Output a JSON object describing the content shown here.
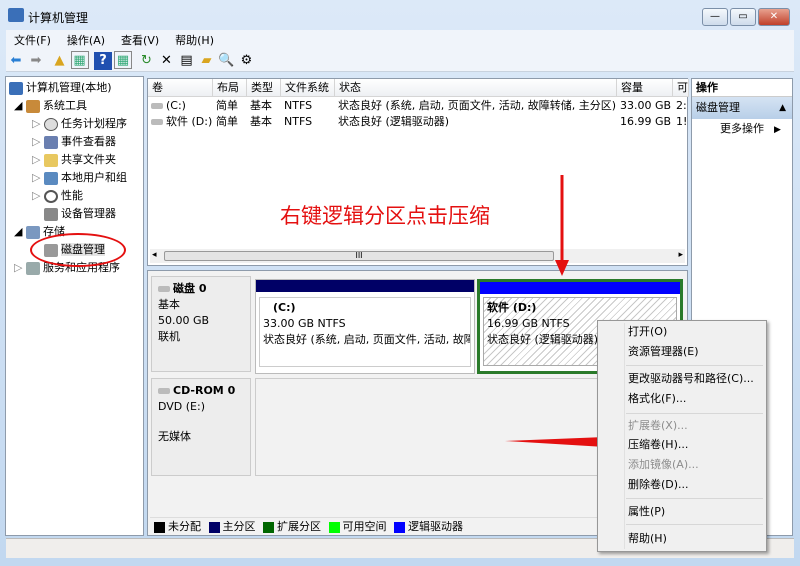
{
  "window": {
    "title": "计算机管理",
    "min": "—",
    "max": "▭",
    "close": "✕"
  },
  "menubar": [
    "文件(F)",
    "操作(A)",
    "查看(V)",
    "帮助(H)"
  ],
  "tree": {
    "root": "计算机管理(本地)",
    "system_tools": "系统工具",
    "task_scheduler": "任务计划程序",
    "event_viewer": "事件查看器",
    "shared_folders": "共享文件夹",
    "local_users": "本地用户和组",
    "performance": "性能",
    "device_manager": "设备管理器",
    "storage": "存储",
    "disk_management": "磁盘管理",
    "services": "服务和应用程序"
  },
  "volume_list": {
    "columns": [
      "卷",
      "布局",
      "类型",
      "文件系统",
      "状态",
      "容量",
      "可"
    ],
    "rows": [
      [
        "(C:)",
        "简单",
        "基本",
        "NTFS",
        "状态良好 (系统, 启动, 页面文件, 活动, 故障转储, 主分区)",
        "33.00 GB",
        "2:"
      ],
      [
        "软件 (D:)",
        "简单",
        "基本",
        "NTFS",
        "状态良好 (逻辑驱动器)",
        "16.99 GB",
        "1!"
      ]
    ],
    "scroll_mid": "III"
  },
  "disks": [
    {
      "name": "磁盘 0",
      "type": "基本",
      "size": "50.00 GB",
      "status": "联机",
      "partitions": [
        {
          "label": "(C:)",
          "size": "33.00 GB NTFS",
          "status": "状态良好 (系统, 启动, 页面文件, 活动, 故障",
          "color": "#000066"
        },
        {
          "label": "软件  (D:)",
          "size": "16.99 GB NTFS",
          "status": "状态良好 (逻辑驱动器)",
          "color": "#0000ff"
        }
      ]
    },
    {
      "name": "CD-ROM 0",
      "type": "DVD (E:)",
      "status": "无媒体"
    }
  ],
  "legend": [
    {
      "label": "未分配",
      "color": "#000000"
    },
    {
      "label": "主分区",
      "color": "#000066"
    },
    {
      "label": "扩展分区",
      "color": "#006600"
    },
    {
      "label": "可用空间",
      "color": "#00ff00"
    },
    {
      "label": "逻辑驱动器",
      "color": "#0000ff"
    }
  ],
  "actions": {
    "header": "操作",
    "section": "磁盘管理",
    "more": "更多操作"
  },
  "context_menu": [
    {
      "label": "打开(O)",
      "enabled": true
    },
    {
      "label": "资源管理器(E)",
      "enabled": true
    },
    {
      "label": "更改驱动器号和路径(C)...",
      "enabled": true
    },
    {
      "label": "格式化(F)...",
      "enabled": true
    },
    {
      "label": "扩展卷(X)...",
      "enabled": false
    },
    {
      "label": "压缩卷(H)...",
      "enabled": true
    },
    {
      "label": "添加镜像(A)...",
      "enabled": false
    },
    {
      "label": "删除卷(D)...",
      "enabled": true
    },
    {
      "label": "属性(P)",
      "enabled": true
    },
    {
      "label": "帮助(H)",
      "enabled": true
    }
  ],
  "annotation": "右键逻辑分区点击压缩"
}
